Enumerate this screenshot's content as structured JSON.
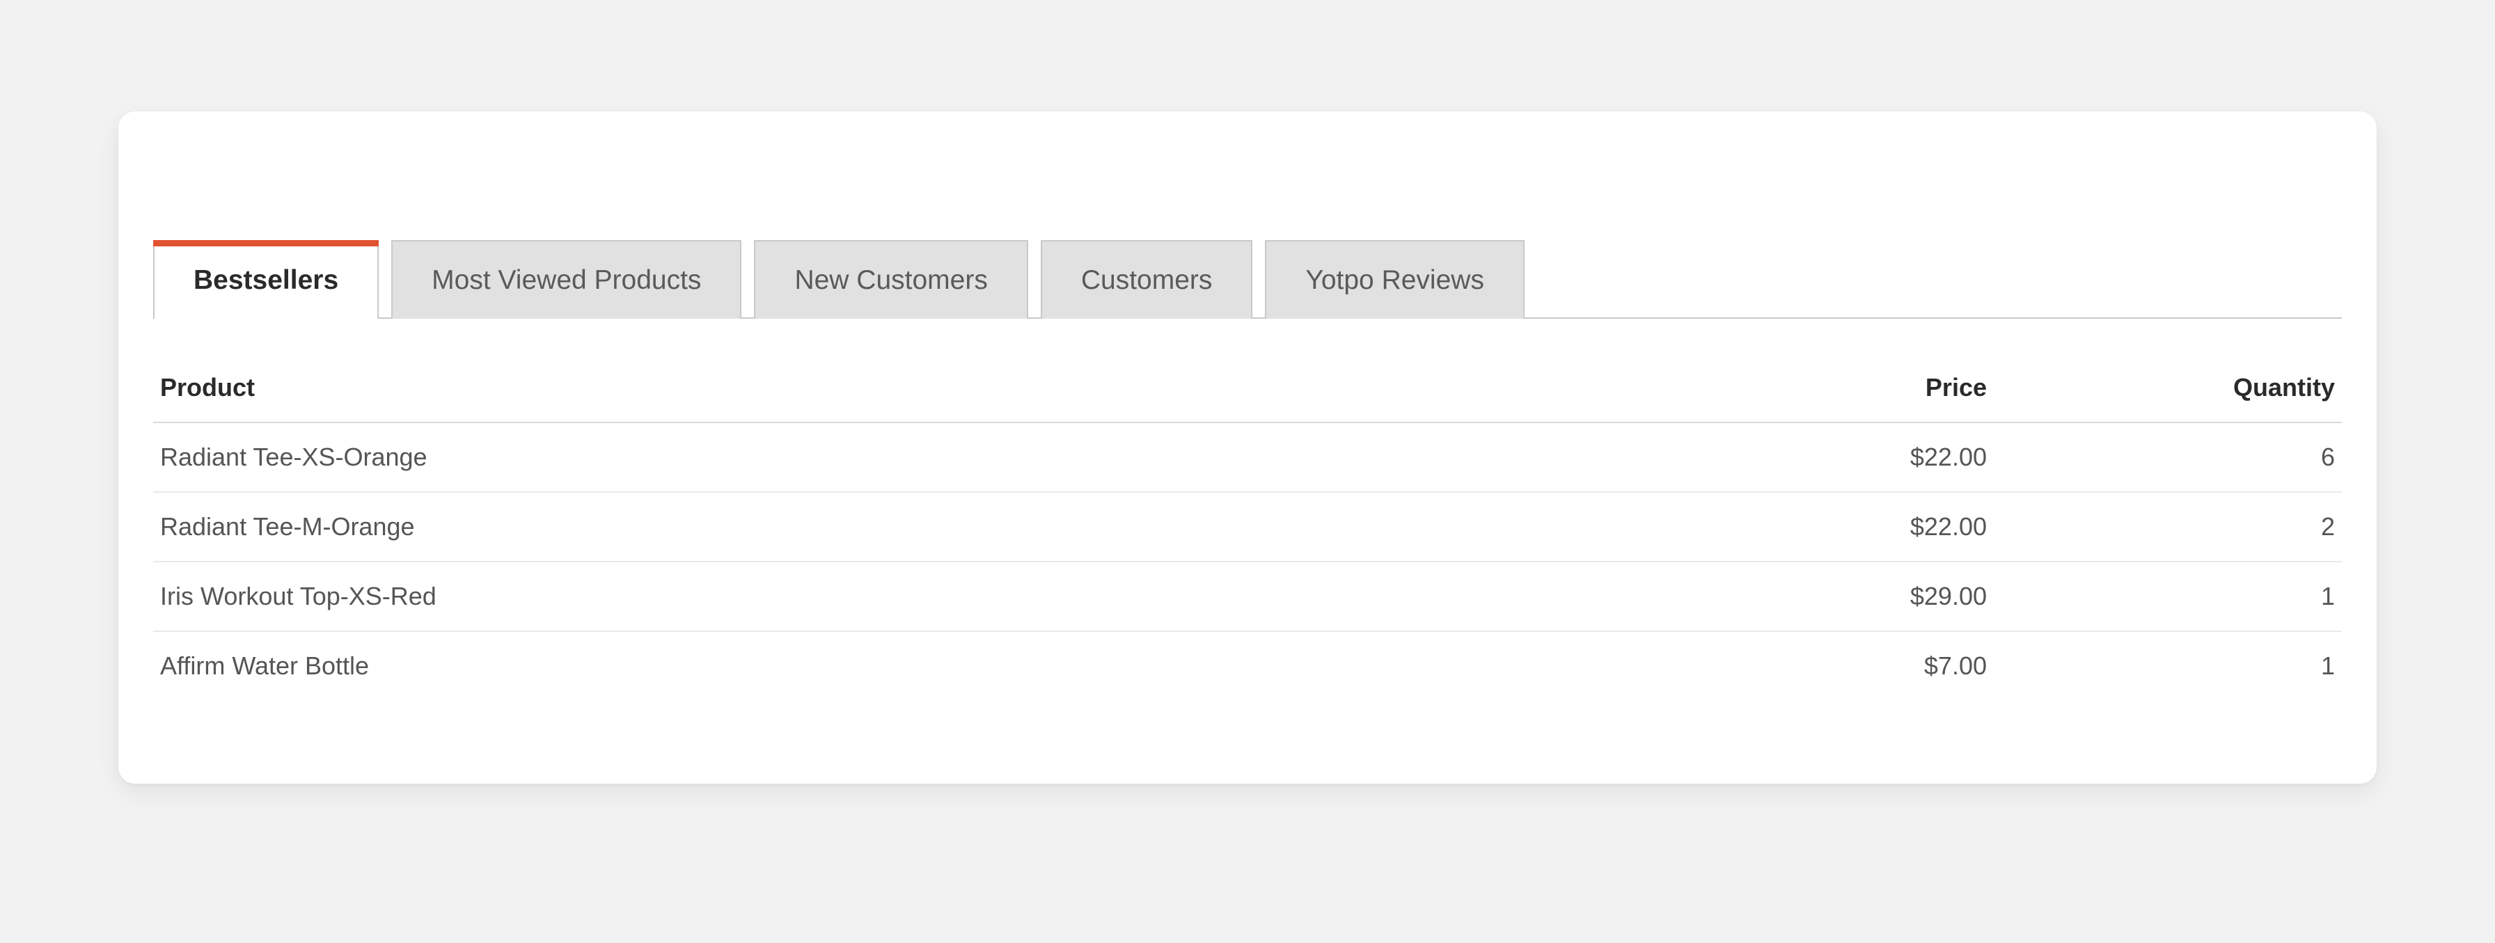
{
  "tabs": [
    {
      "id": "bestsellers",
      "label": "Bestsellers",
      "active": true
    },
    {
      "id": "most-viewed",
      "label": "Most Viewed Products",
      "active": false
    },
    {
      "id": "new-cust",
      "label": "New Customers",
      "active": false
    },
    {
      "id": "customers",
      "label": "Customers",
      "active": false
    },
    {
      "id": "yotpo",
      "label": "Yotpo Reviews",
      "active": false
    }
  ],
  "table": {
    "headers": {
      "product": "Product",
      "price": "Price",
      "qty": "Quantity"
    },
    "rows": [
      {
        "product": "Radiant Tee-XS-Orange",
        "price": "$22.00",
        "qty": "6"
      },
      {
        "product": "Radiant Tee-M-Orange",
        "price": "$22.00",
        "qty": "2"
      },
      {
        "product": "Iris Workout Top-XS-Red",
        "price": "$29.00",
        "qty": "1"
      },
      {
        "product": "Affirm Water Bottle",
        "price": "$7.00",
        "qty": "1"
      }
    ]
  }
}
